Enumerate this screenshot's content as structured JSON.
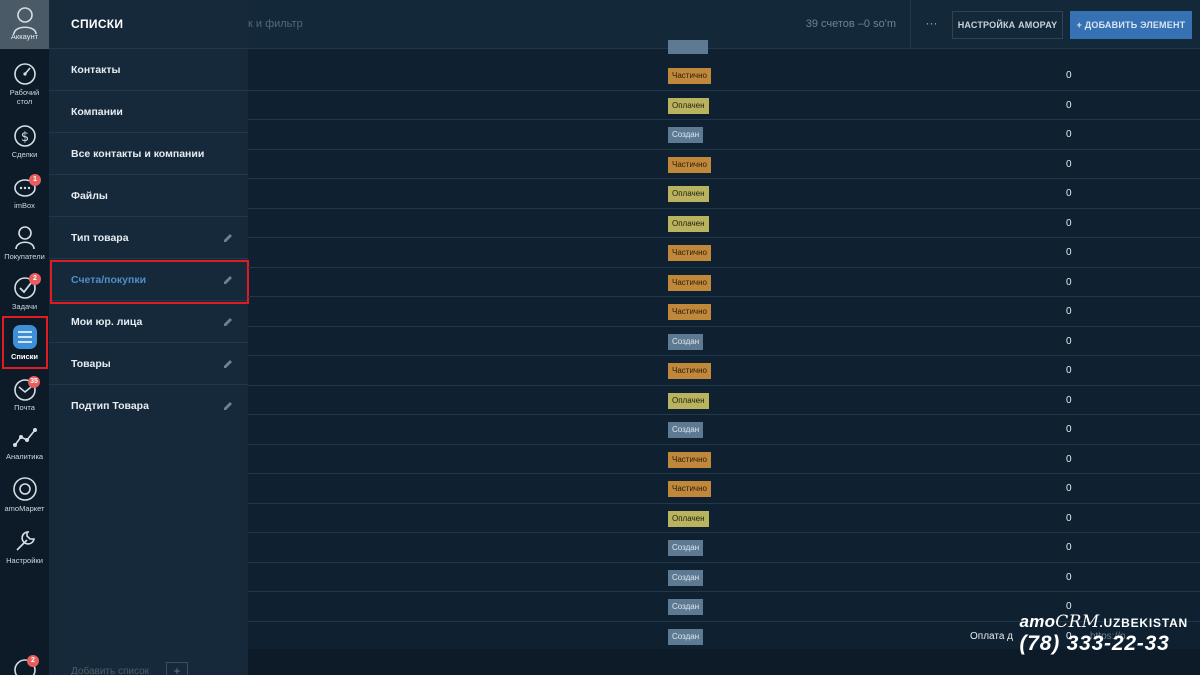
{
  "rail": {
    "account": "Аккаунт",
    "items": [
      {
        "label": "Рабочий стол",
        "icon": "dashboard-icon"
      },
      {
        "label": "Сделки",
        "icon": "dollar-icon"
      },
      {
        "label": "imBox",
        "icon": "chat-icon",
        "badge": "1"
      },
      {
        "label": "Покупатели",
        "icon": "customer-icon"
      },
      {
        "label": "Задачи",
        "icon": "checkmark-icon",
        "badge": "2"
      },
      {
        "label": "Списки",
        "icon": "lists-icon",
        "active": true
      },
      {
        "label": "Почта",
        "icon": "mail-icon",
        "badge": "35"
      },
      {
        "label": "Аналитика",
        "icon": "analytics-icon"
      },
      {
        "label": "amoМаркет",
        "icon": "market-icon"
      },
      {
        "label": "Настройки",
        "icon": "wrench-icon"
      }
    ],
    "bottom_badge": "2"
  },
  "lists_panel": {
    "title": "СПИСКИ",
    "items": [
      {
        "label": "Контакты"
      },
      {
        "label": "Компании"
      },
      {
        "label": "Все контакты и компании"
      },
      {
        "label": "Файлы"
      },
      {
        "label": "Тип товара",
        "editable": true
      },
      {
        "label": "Счета/покупки",
        "editable": true,
        "active": true
      },
      {
        "label": "Мои юр. лица",
        "editable": true
      },
      {
        "label": "Товары",
        "editable": true
      },
      {
        "label": "Подтип Товара",
        "editable": true
      }
    ],
    "add_list": "Добавить список",
    "add_plus": "+"
  },
  "topbar": {
    "search_placeholder": "к и фильтр",
    "counter": "39 счетов –0 so'm",
    "more": "···",
    "amopay_button": "НАСТРОЙКА AMOPAY",
    "add_button": "+ ДОБАВИТЬ ЭЛЕМЕНТ"
  },
  "table": {
    "rows": [
      {
        "status": "Частично",
        "type": "partial",
        "amount": "0"
      },
      {
        "status": "Оплачен",
        "type": "paid",
        "amount": "0"
      },
      {
        "status": "Создан",
        "type": "created",
        "amount": "0"
      },
      {
        "status": "Частично",
        "type": "partial",
        "amount": "0"
      },
      {
        "status": "Оплачен",
        "type": "paid",
        "amount": "0"
      },
      {
        "status": "Оплачен",
        "type": "paid",
        "amount": "0"
      },
      {
        "status": "Частично",
        "type": "partial",
        "amount": "0"
      },
      {
        "status": "Частично",
        "type": "partial",
        "amount": "0"
      },
      {
        "status": "Частично",
        "type": "partial",
        "amount": "0"
      },
      {
        "status": "Создан",
        "type": "created",
        "amount": "0"
      },
      {
        "status": "Частично",
        "type": "partial",
        "amount": "0"
      },
      {
        "status": "Оплачен",
        "type": "paid",
        "amount": "0"
      },
      {
        "status": "Создан",
        "type": "created",
        "amount": "0"
      },
      {
        "status": "Частично",
        "type": "partial",
        "amount": "0"
      },
      {
        "status": "Частично",
        "type": "partial",
        "amount": "0"
      },
      {
        "status": "Оплачен",
        "type": "paid",
        "amount": "0"
      },
      {
        "status": "Создан",
        "type": "created",
        "amount": "0"
      },
      {
        "status": "Создан",
        "type": "created",
        "amount": "0"
      },
      {
        "status": "Создан",
        "type": "created",
        "amount": "0"
      },
      {
        "status": "Создан",
        "type": "created",
        "amount": "0"
      }
    ],
    "footer_label": "Оплата д",
    "footer_link": "https://p"
  },
  "watermark": {
    "brand_amo": "amo",
    "brand_crm": "CRM",
    "brand_uz": ".UZBEKISTAN",
    "phone": "(78) 333-22-33"
  },
  "colors": {
    "partial": "#c0883b",
    "paid": "#b9b35f",
    "created": "#5e7a92",
    "accent": "#3671b3",
    "highlight": "#e11b22"
  }
}
